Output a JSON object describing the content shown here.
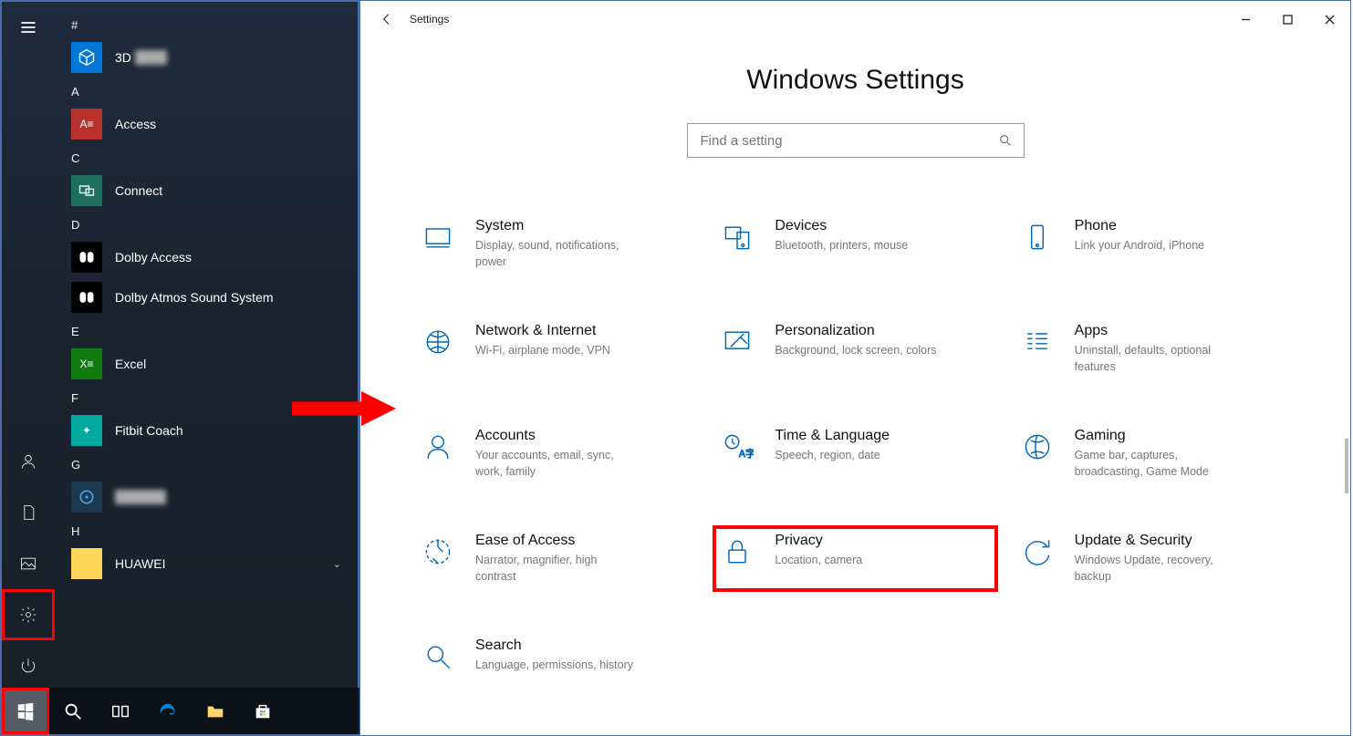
{
  "start_menu": {
    "headers": {
      "hash": "#",
      "a": "A",
      "c": "C",
      "d": "D",
      "e": "E",
      "f": "F",
      "g": "G",
      "h": "H"
    },
    "apps": {
      "threeD": "3D",
      "access": "Access",
      "connect": "Connect",
      "dolby_access": "Dolby Access",
      "dolby_atmos": "Dolby Atmos Sound System",
      "excel": "Excel",
      "fitbit": "Fitbit Coach",
      "g_app": "",
      "huawei": "HUAWEI"
    }
  },
  "settings": {
    "caption": "Settings",
    "page_title": "Windows Settings",
    "search_placeholder": "Find a setting",
    "cats": {
      "system": {
        "t": "System",
        "d": "Display, sound, notifications, power"
      },
      "devices": {
        "t": "Devices",
        "d": "Bluetooth, printers, mouse"
      },
      "phone": {
        "t": "Phone",
        "d": "Link your Android, iPhone"
      },
      "network": {
        "t": "Network & Internet",
        "d": "Wi-Fi, airplane mode, VPN"
      },
      "personalization": {
        "t": "Personalization",
        "d": "Background, lock screen, colors"
      },
      "apps": {
        "t": "Apps",
        "d": "Uninstall, defaults, optional features"
      },
      "accounts": {
        "t": "Accounts",
        "d": "Your accounts, email, sync, work, family"
      },
      "time": {
        "t": "Time & Language",
        "d": "Speech, region, date"
      },
      "gaming": {
        "t": "Gaming",
        "d": "Game bar, captures, broadcasting, Game Mode"
      },
      "ease": {
        "t": "Ease of Access",
        "d": "Narrator, magnifier, high contrast"
      },
      "privacy": {
        "t": "Privacy",
        "d": "Location, camera"
      },
      "update": {
        "t": "Update & Security",
        "d": "Windows Update, recovery, backup"
      },
      "search": {
        "t": "Search",
        "d": "Language, permissions, history"
      }
    }
  }
}
